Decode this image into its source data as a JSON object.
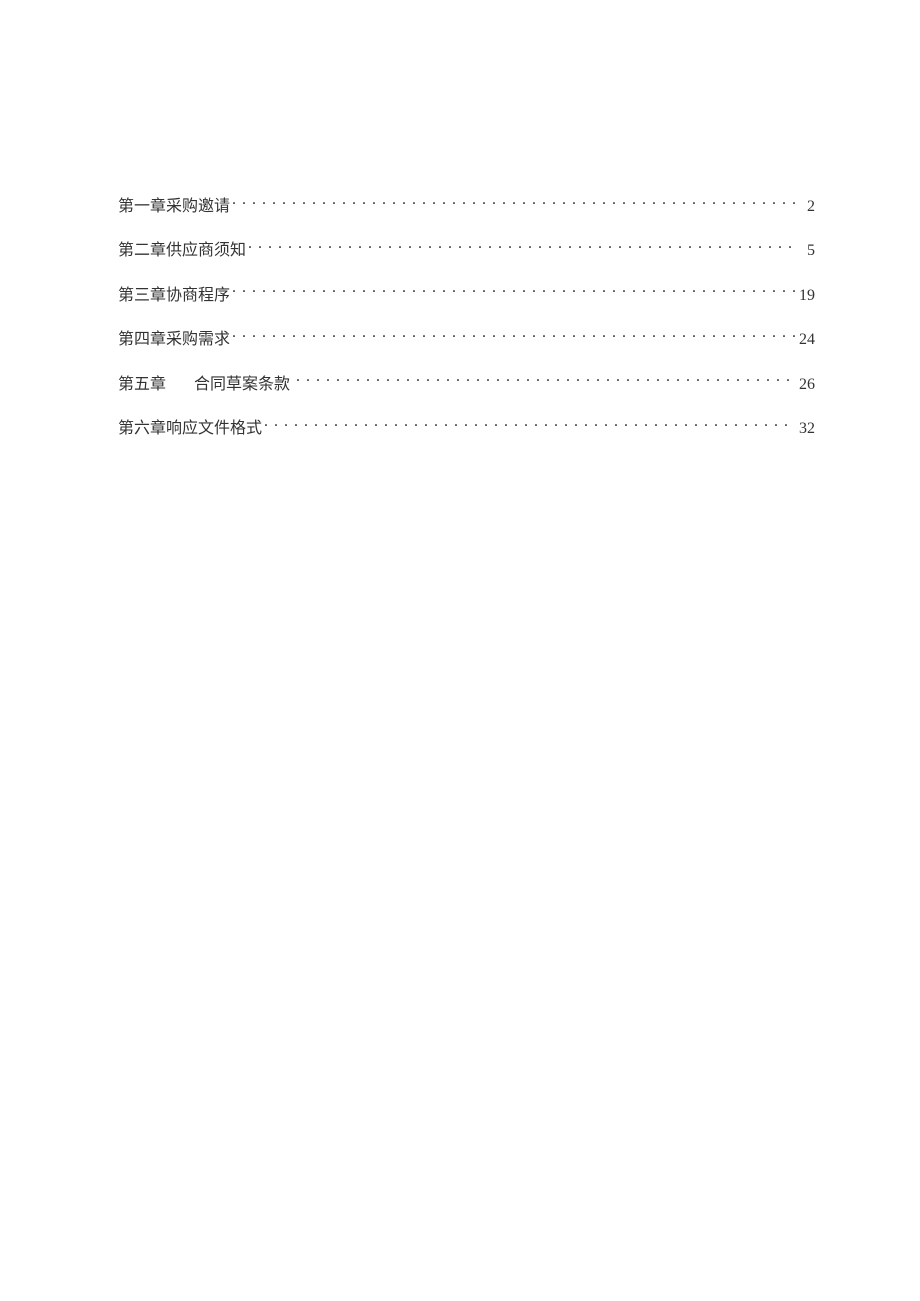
{
  "toc": {
    "entries": [
      {
        "prefix": "第一章",
        "title": "采购邀请",
        "page": "2",
        "wide_gap": false
      },
      {
        "prefix": "第二章",
        "title": "供应商须知",
        "page": "5",
        "wide_gap": false
      },
      {
        "prefix": "第三章",
        "title": "协商程序",
        "page": "19",
        "wide_gap": false
      },
      {
        "prefix": "第四章",
        "title": "采购需求",
        "page": "24",
        "wide_gap": false
      },
      {
        "prefix": "第五章",
        "title": "合同草案条款",
        "page": "26",
        "wide_gap": true
      },
      {
        "prefix": "第六章",
        "title": "响应文件格式",
        "page": "32",
        "wide_gap": false
      }
    ]
  }
}
